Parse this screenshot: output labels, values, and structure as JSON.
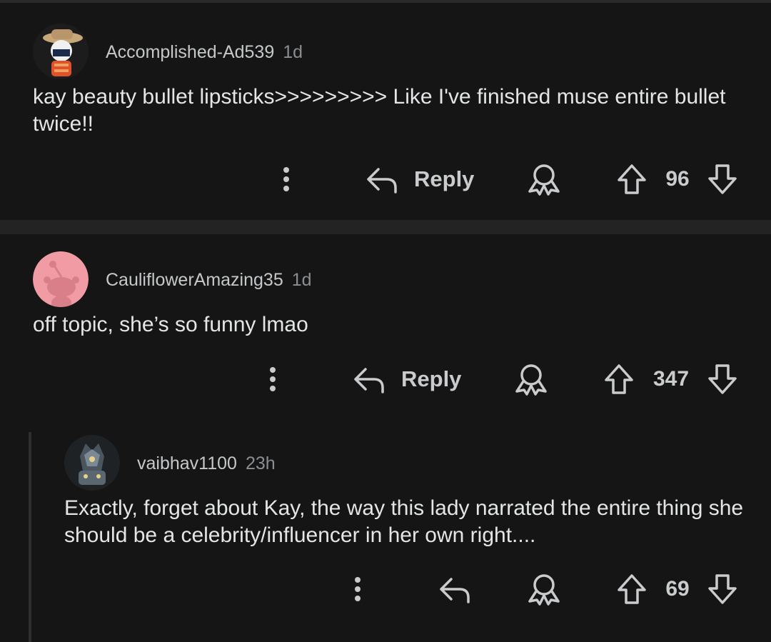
{
  "comments": [
    {
      "username": "Accomplished-Ad539",
      "time": "1d",
      "text": "kay beauty bullet lipsticks>>>>>>>>> Like I've finished muse entire bullet twice!!",
      "reply_label": "Reply",
      "score": "96",
      "avatar": "snoo-cowboy-hat-avatar"
    },
    {
      "username": "CauliflowerAmazing35",
      "time": "1d",
      "text": "off topic, she’s so funny lmao",
      "reply_label": "Reply",
      "score": "347",
      "avatar": "default-snoo-pink-avatar"
    },
    {
      "username": "vaibhav1100",
      "time": "23h",
      "text": "Exactly, forget about Kay, the way this lady narrated the entire thing she should be a celebrity/influencer in her own right....",
      "score": "69",
      "avatar": "armored-knight-avatar"
    }
  ],
  "colors": {
    "background": "#151515",
    "separator": "#232323",
    "text": "#e4e5e6",
    "muted": "#8b8e90"
  }
}
